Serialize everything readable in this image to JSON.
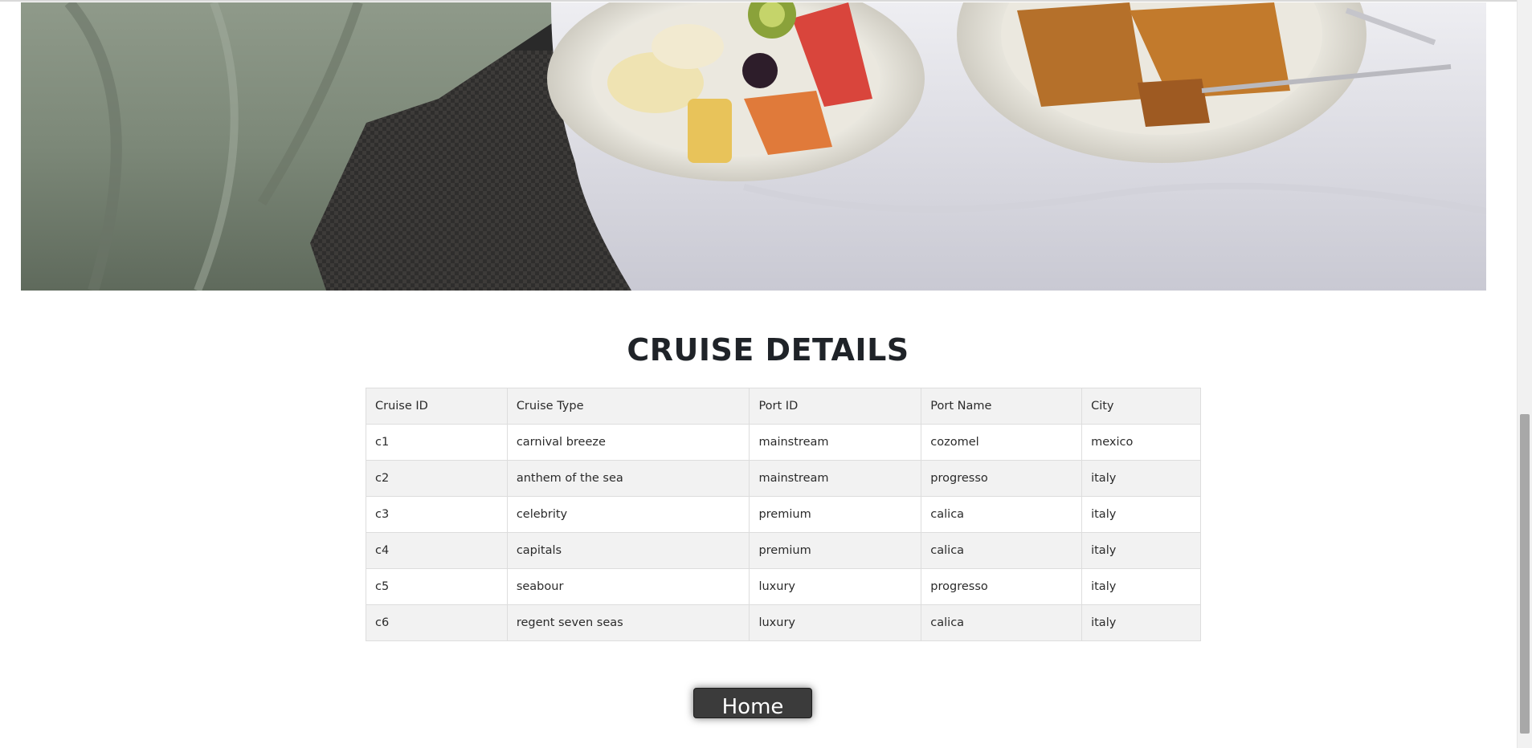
{
  "page": {
    "title": "CRUISE DETAILS",
    "banner_alt": "breakfast plates with fruit and waffles",
    "home_label": "Home"
  },
  "table": {
    "headers": [
      "Cruise ID",
      "Cruise Type",
      "Port ID",
      "Port Name",
      "City"
    ],
    "rows": [
      [
        "c1",
        "carnival breeze",
        "mainstream",
        "cozomel",
        "mexico"
      ],
      [
        "c2",
        "anthem of the sea",
        "mainstream",
        "progresso",
        "italy"
      ],
      [
        "c3",
        "celebrity",
        "premium",
        "calica",
        "italy"
      ],
      [
        "c4",
        "capitals",
        "premium",
        "calica",
        "italy"
      ],
      [
        "c5",
        "seabour",
        "luxury",
        "progresso",
        "italy"
      ],
      [
        "c6",
        "regent seven seas",
        "luxury",
        "calica",
        "italy"
      ]
    ]
  },
  "colors": {
    "header_bg": "#f2f2f2",
    "stripe_bg": "#f2f2f2",
    "border": "#dddddd",
    "button_bg": "#3b3b3b"
  }
}
